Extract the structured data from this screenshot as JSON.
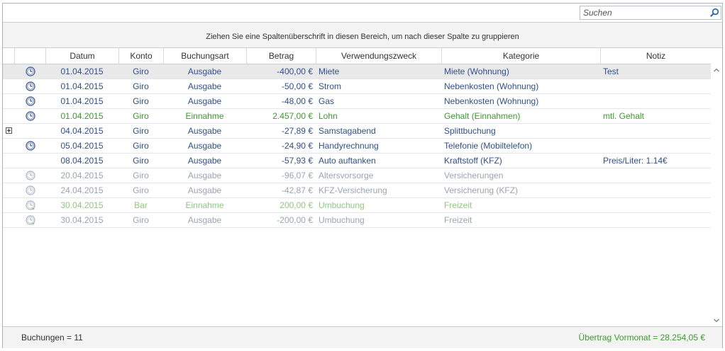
{
  "search": {
    "placeholder": "Suchen",
    "value": ""
  },
  "group_panel": {
    "text": "Ziehen Sie eine Spaltenüberschrift in diesen Bereich, um nach dieser Spalte zu gruppieren"
  },
  "columns": [
    "",
    "",
    "Datum",
    "Konto",
    "Buchungsart",
    "Betrag",
    "Verwendungszweck",
    "Kategorie",
    "Notiz"
  ],
  "rows": [
    {
      "state": "normal",
      "icon": "clock-icon",
      "expand": false,
      "selected": true,
      "datum": "01.04.2015",
      "konto": "Giro",
      "art": "Ausgabe",
      "betrag": "-400,00 €",
      "zweck": "Miete",
      "kategorie": "Miete (Wohnung)",
      "notiz": "Test"
    },
    {
      "state": "normal",
      "icon": "clock-icon",
      "expand": false,
      "selected": false,
      "datum": "01.04.2015",
      "konto": "Giro",
      "art": "Ausgabe",
      "betrag": "-50,00 €",
      "zweck": "Strom",
      "kategorie": "Nebenkosten (Wohnung)",
      "notiz": ""
    },
    {
      "state": "normal",
      "icon": "clock-icon",
      "expand": false,
      "selected": false,
      "datum": "01.04.2015",
      "konto": "Giro",
      "art": "Ausgabe",
      "betrag": "-48,00 €",
      "zweck": "Gas",
      "kategorie": "Nebenkosten (Wohnung)",
      "notiz": ""
    },
    {
      "state": "income",
      "icon": "clock-icon",
      "expand": false,
      "selected": false,
      "datum": "01.04.2015",
      "konto": "Giro",
      "art": "Einnahme",
      "betrag": "2.457,00 €",
      "zweck": "Lohn",
      "kategorie": "Gehalt (Einnahmen)",
      "notiz": "mtl. Gehalt"
    },
    {
      "state": "normal",
      "icon": "",
      "expand": true,
      "selected": false,
      "datum": "04.04.2015",
      "konto": "Giro",
      "art": "Ausgabe",
      "betrag": "-27,89 €",
      "zweck": "Samstagabend",
      "kategorie": "Splittbuchung",
      "notiz": ""
    },
    {
      "state": "normal",
      "icon": "clock-icon",
      "expand": false,
      "selected": false,
      "datum": "05.04.2015",
      "konto": "Giro",
      "art": "Ausgabe",
      "betrag": "-24,90 €",
      "zweck": "Handyrechnung",
      "kategorie": "Telefonie (Mobiltelefon)",
      "notiz": ""
    },
    {
      "state": "normal",
      "icon": "",
      "expand": false,
      "selected": false,
      "datum": "08.04.2015",
      "konto": "Giro",
      "art": "Ausgabe",
      "betrag": "-57,93 €",
      "zweck": "Auto auftanken",
      "kategorie": "Kraftstoff (KFZ)",
      "notiz": "Preis/Liter: 1.14€"
    },
    {
      "state": "plan",
      "icon": "clock-icon",
      "expand": false,
      "selected": false,
      "datum": "20.04.2015",
      "konto": "Giro",
      "art": "Ausgabe",
      "betrag": "-96,07 €",
      "zweck": "Altersvorsorge",
      "kategorie": "Versicherungen",
      "notiz": ""
    },
    {
      "state": "plan",
      "icon": "clock-icon",
      "expand": false,
      "selected": false,
      "datum": "24.04.2015",
      "konto": "Giro",
      "art": "Ausgabe",
      "betrag": "-42,87 €",
      "zweck": "KFZ-Versicherung",
      "kategorie": "Versicherung (KFZ)",
      "notiz": ""
    },
    {
      "state": "plan-income",
      "icon": "transfer-clock-icon",
      "expand": false,
      "selected": false,
      "datum": "30.04.2015",
      "konto": "Bar",
      "art": "Einnahme",
      "betrag": "200,00 €",
      "zweck": "Umbuchung",
      "kategorie": "Freizeit",
      "notiz": ""
    },
    {
      "state": "plan",
      "icon": "transfer-clock-icon",
      "expand": false,
      "selected": false,
      "datum": "30.04.2015",
      "konto": "Giro",
      "art": "Ausgabe",
      "betrag": "-200,00 €",
      "zweck": "Umbuchung",
      "kategorie": "Freizeit",
      "notiz": ""
    }
  ],
  "footer": {
    "count": "Buchungen = 11",
    "carryover": "Übertrag Vormonat = 28.254,05 €"
  },
  "colors": {
    "normal": "#2f4f8f",
    "income": "#3b9a2e",
    "plan": "#9aa4b2",
    "plan_income": "#8dc97f",
    "selected_row": "#e9e9e9"
  }
}
